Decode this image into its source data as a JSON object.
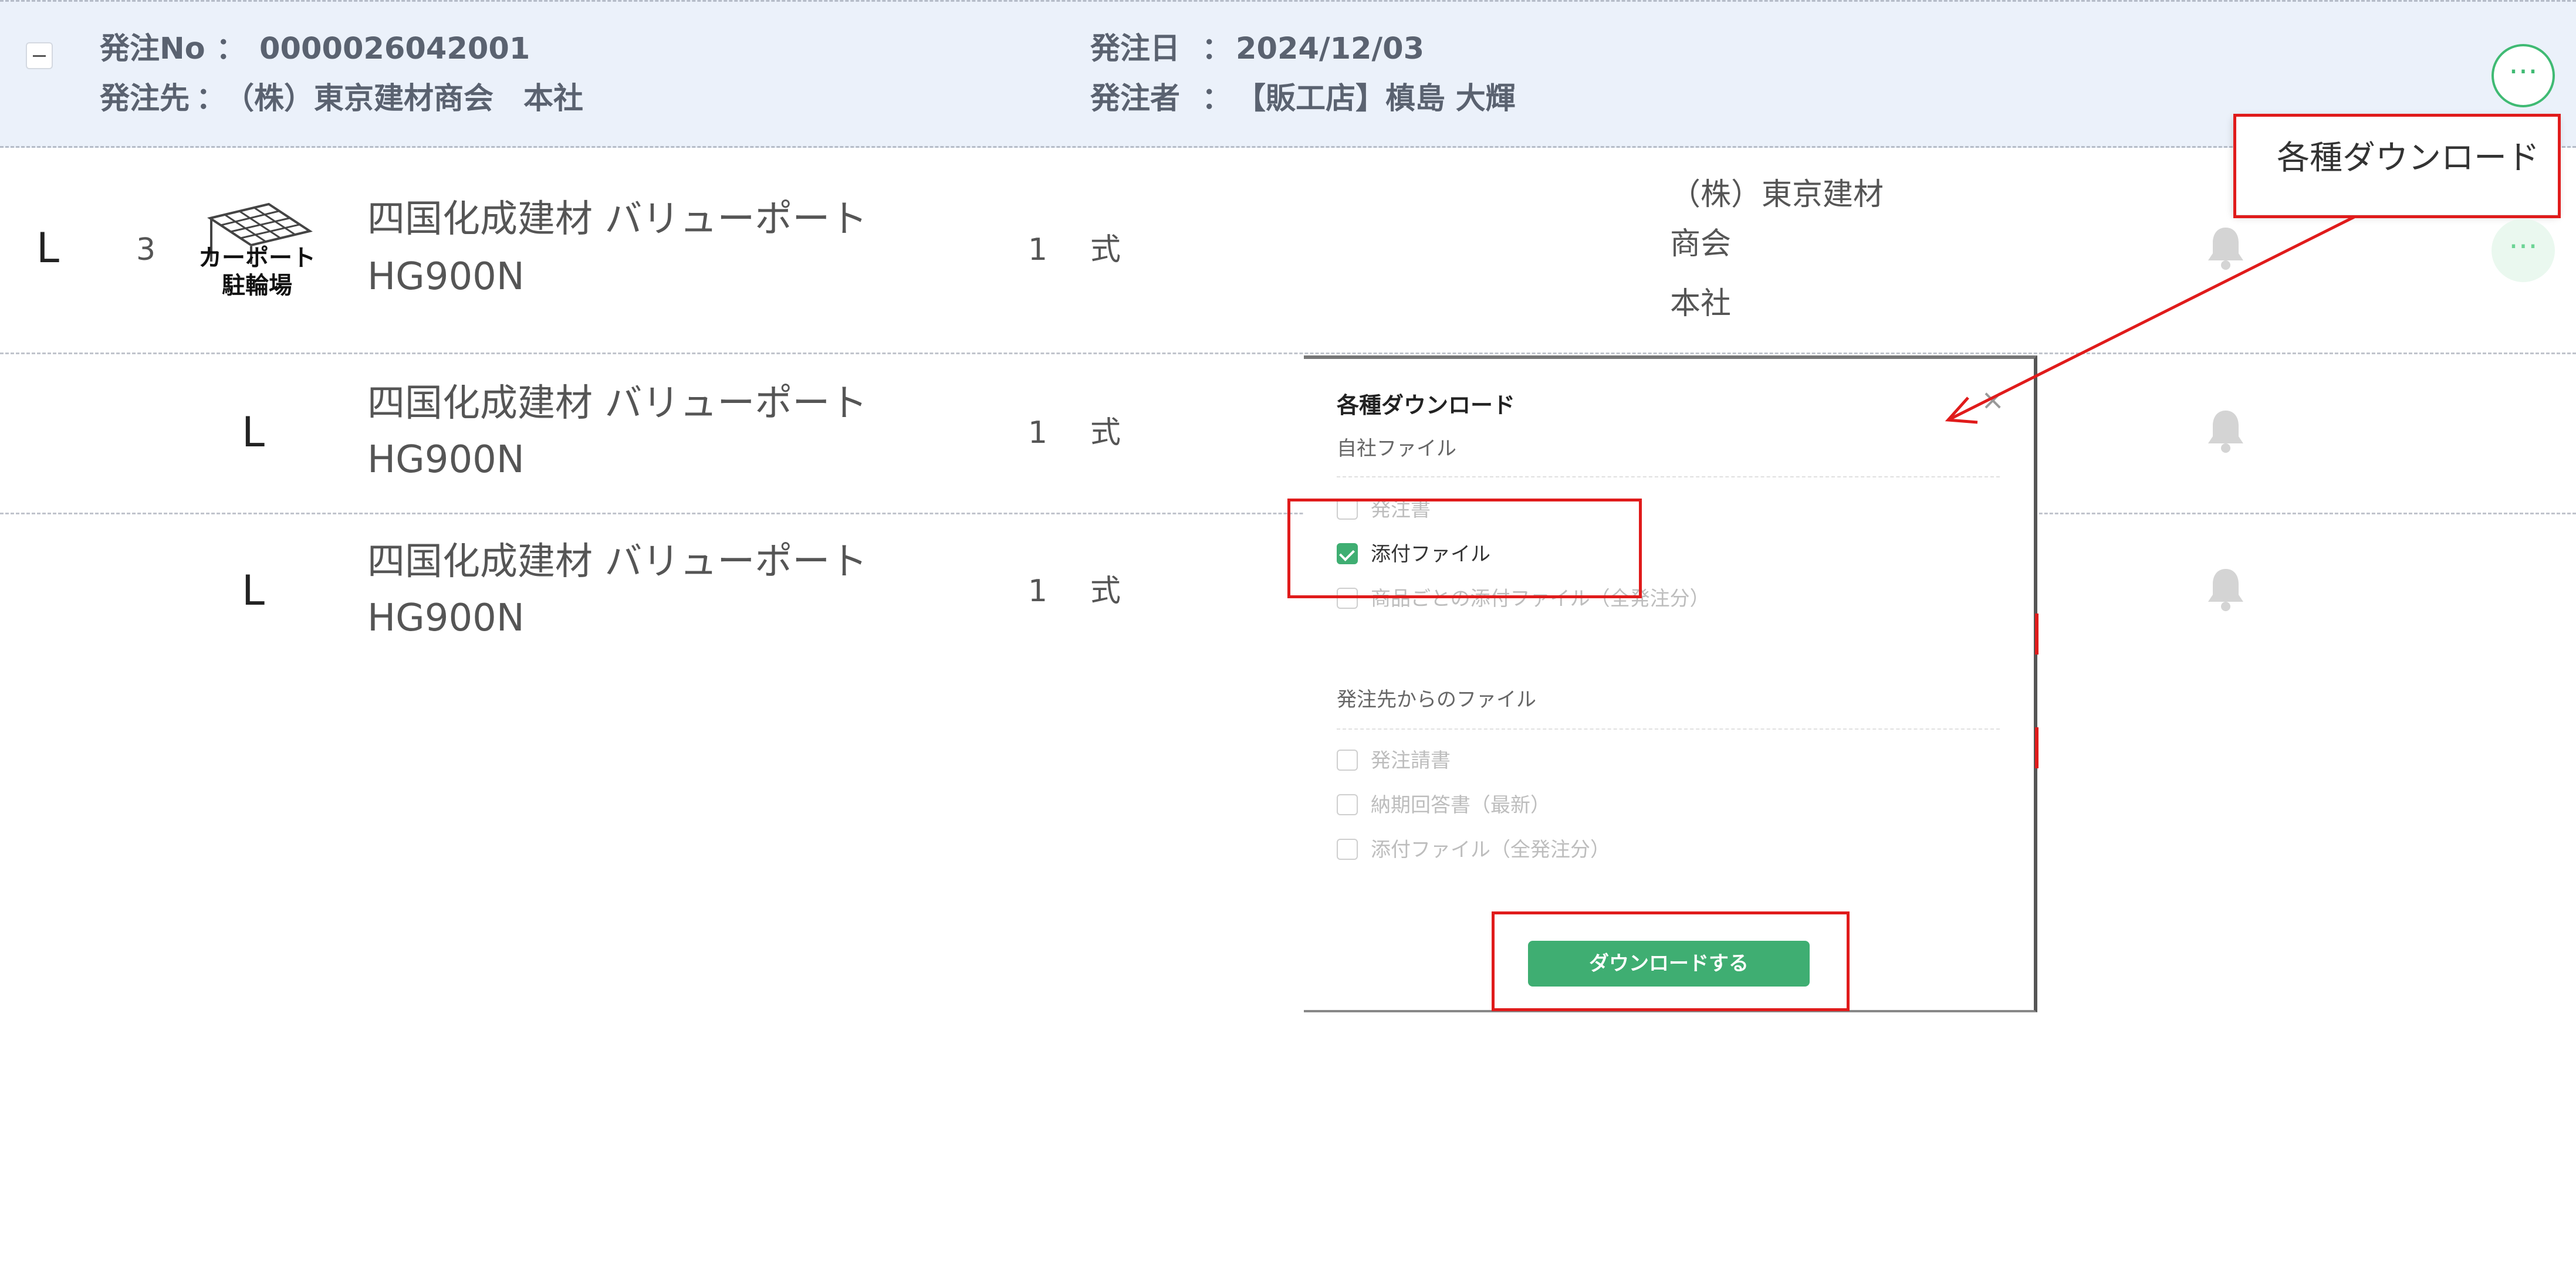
{
  "order": {
    "no_label": "発注No",
    "no_value": "0000026042001",
    "supplier_label": "発注先",
    "supplier_value": "（株）東京建材商会　本社",
    "date_label": "発注日",
    "date_value": "2024/12/03",
    "orderer_label": "発注者",
    "orderer_value": "【販工店】槙島 大輝",
    "separator": "："
  },
  "menu": {
    "dots": "···",
    "download_item": "各種ダウンロード"
  },
  "rows": [
    {
      "prefix": "L",
      "index": "3",
      "thumb_line1": "カーポート",
      "thumb_line2": "駐輪場",
      "product_line1": "四国化成建材 バリューポート",
      "product_line2": "HG900N",
      "qty": "1",
      "unit": "式",
      "supplier_line1": "（株）東京建材",
      "supplier_line2": "商会",
      "supplier_line3": "本社"
    },
    {
      "prefix": "L",
      "product_line1": "四国化成建材 バリューポート",
      "product_line2": "HG900N",
      "qty": "1",
      "unit": "式"
    },
    {
      "prefix": "L",
      "product_line1": "四国化成建材 バリューポート",
      "product_line2": "HG900N",
      "qty": "1",
      "unit": "式"
    }
  ],
  "modal": {
    "title": "各種ダウンロード",
    "close": "×",
    "own_section": "自社ファイル",
    "own_items": [
      {
        "label": "発注書",
        "checked": false
      },
      {
        "label": "添付ファイル",
        "checked": true
      },
      {
        "label": "商品ごとの添付ファイル（全発注分）",
        "checked": false
      }
    ],
    "partner_section": "発注先からのファイル",
    "partner_items": [
      {
        "label": "発注請書",
        "checked": false
      },
      {
        "label": "納期回答書（最新）",
        "checked": false
      },
      {
        "label": "添付ファイル（全発注分）",
        "checked": false
      }
    ],
    "download_button": "ダウンロードする"
  },
  "colors": {
    "accent": "#3fae72",
    "header_bg": "#ebf1fa",
    "annotation": "#e01b1b"
  }
}
